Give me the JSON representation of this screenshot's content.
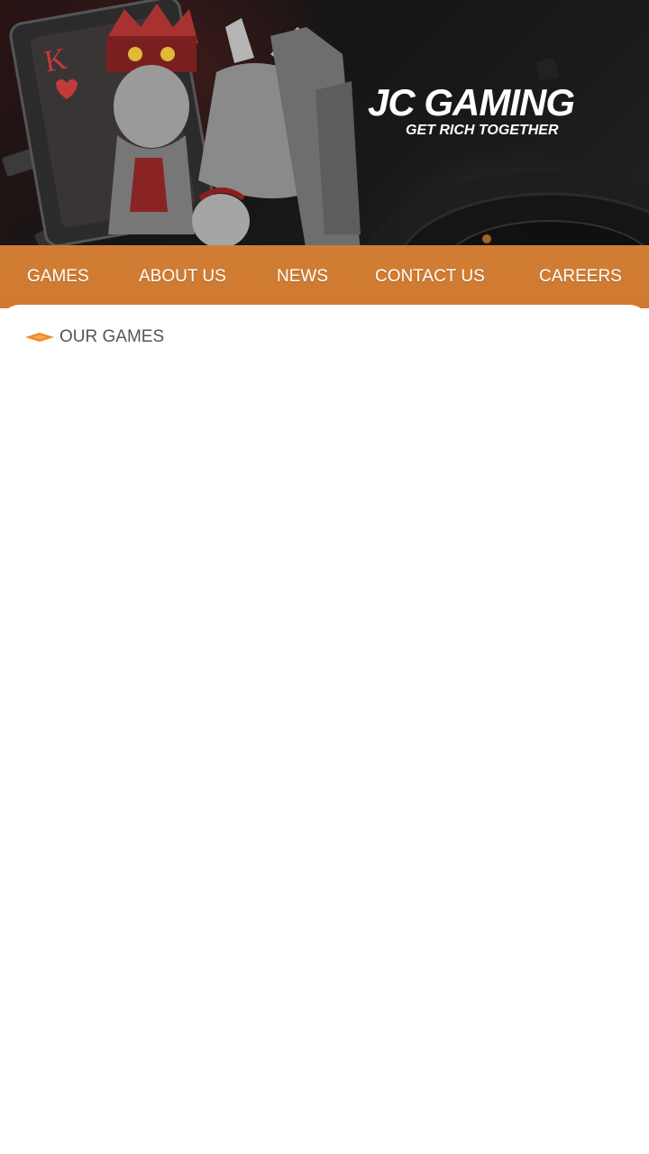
{
  "hero": {
    "brand_title": "JC GAMING",
    "brand_tagline": "GET RICH TOGETHER",
    "background_art": "king-card-and-roulette-illustration"
  },
  "nav": {
    "items": [
      {
        "label": "GAMES"
      },
      {
        "label": "ABOUT US"
      },
      {
        "label": "NEWS"
      },
      {
        "label": "CONTACT  US"
      },
      {
        "label": "CAREERS"
      }
    ]
  },
  "section": {
    "title": "OUR GAMES",
    "icon": "orange-diamond-icon"
  },
  "colors": {
    "accent": "#d07d33",
    "icon_accent": "#f08a24",
    "section_title": "#555555",
    "hero_dark": "#151515"
  }
}
